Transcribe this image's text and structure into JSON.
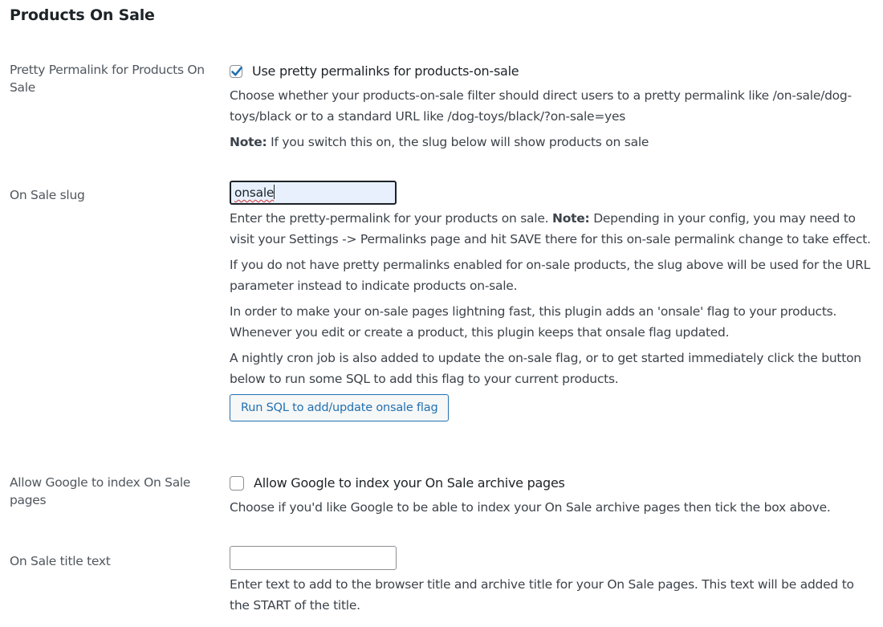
{
  "section": {
    "title": "Products On Sale"
  },
  "pretty_permalink": {
    "label": "Pretty Permalink for Products On Sale",
    "checkbox_label": "Use pretty permalinks for products-on-sale",
    "checked": true,
    "desc": "Choose whether your products-on-sale filter should direct users to a pretty permalink like /on-sale/dog-toys/black or to a standard URL like /dog-toys/black/?on-sale=yes",
    "note_label": "Note:",
    "note_text": " If you switch this on, the slug below will show products on sale"
  },
  "slug": {
    "label": "On Sale slug",
    "value": "onsale",
    "desc1_before": "Enter the pretty-permalink for your products on sale. ",
    "desc1_note": "Note:",
    "desc1_after": " Depending in your config, you may need to visit your Settings -> Permalinks page and hit SAVE there for this on-sale permalink change to take effect.",
    "desc2": "If you do not have pretty permalinks enabled for on-sale products, the slug above will be used for the URL parameter instead to indicate products on-sale.",
    "desc3": "In order to make your on-sale pages lightning fast, this plugin adds an 'onsale' flag to your products. Whenever you edit or create a product, this plugin keeps that onsale flag updated.",
    "desc4": "A nightly cron job is also added to update the on-sale flag, or to get started immediately click the button below to run some SQL to add this flag to your current products.",
    "button_label": "Run SQL to add/update onsale flag"
  },
  "google_index": {
    "label": "Allow Google to index On Sale pages",
    "checkbox_label": "Allow Google to index your On Sale archive pages",
    "checked": false,
    "desc": "Choose if you'd like Google to be able to index your On Sale archive pages then tick the box above."
  },
  "title_text": {
    "label": "On Sale title text",
    "value": "",
    "desc": "Enter text to add to the browser title and archive title for your On Sale pages. This text will be added to the START of the title."
  },
  "colors": {
    "accent": "#2271b1",
    "checkmark": "#2271b1",
    "label_text": "#50575e",
    "body_text": "#3c434a",
    "focused_input_bg": "#e8f0fe",
    "spellcheck_underline": "#d63638"
  },
  "icons": {
    "checkmark": "check-icon"
  }
}
